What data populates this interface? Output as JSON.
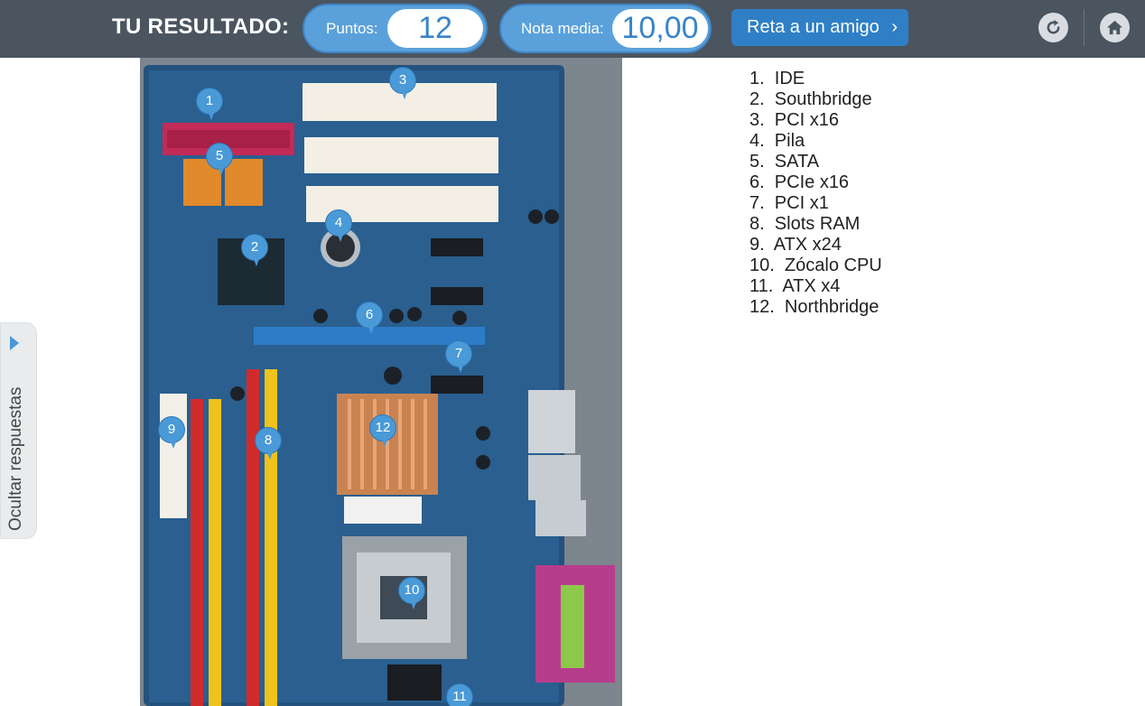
{
  "header": {
    "title": "TU RESULTADO:",
    "points_label": "Puntos:",
    "points_value": "12",
    "grade_label": "Nota media:",
    "grade_value": "10,00",
    "challenge_label": "Reta a un amigo",
    "challenge_icon": "chevron-right-icon",
    "reload_icon": "reload-icon",
    "home_icon": "home-icon"
  },
  "side_tab": {
    "label": "Ocultar respuestas",
    "icon": "triangle-right-icon"
  },
  "colors": {
    "topbar": "#4a5560",
    "pill": "#5aa1db",
    "accent": "#2e7fc6",
    "marker": "#4a9ad7"
  },
  "markers": [
    "1",
    "2",
    "3",
    "4",
    "5",
    "6",
    "7",
    "8",
    "9",
    "10",
    "11",
    "12"
  ],
  "answers": [
    "1.  IDE",
    "2.  Southbridge",
    "3.  PCI x16",
    "4.  Pila",
    "5.  SATA",
    "6.  PCIe x16",
    "7.  PCI x1",
    "8.  Slots RAM",
    "9.  ATX x24",
    "10.  Zócalo CPU",
    "11.  ATX x4",
    "12.  Northbridge"
  ]
}
